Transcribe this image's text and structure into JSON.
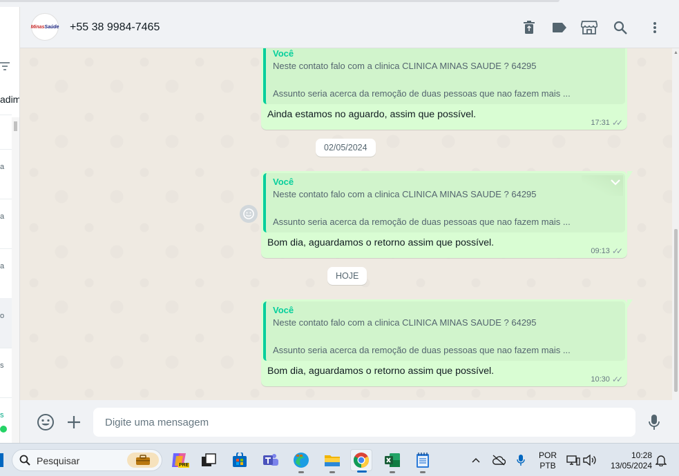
{
  "left_panel": {
    "fragments": [
      "adim",
      "a",
      "a",
      "a",
      "o",
      "s",
      "s"
    ]
  },
  "header": {
    "avatar_text_a": "Minas",
    "avatar_text_b": "Saúde",
    "contact_name": "+55 38 9984-7465"
  },
  "chat": {
    "messages": [
      {
        "quote_author": "Você",
        "quote_line1": "Neste contato falo com a clinica  CLINICA MINAS SAUDE ? 64295",
        "quote_line2": "Assunto seria acerca da remoção de duas pessoas que nao fazem mais ...",
        "text": "Ainda estamos no aguardo, assim que possível.",
        "time": "17:31",
        "ticks": "✓✓"
      },
      {
        "quote_author": "Você",
        "quote_line1": "Neste contato falo com a clinica  CLINICA MINAS SAUDE ? 64295",
        "quote_line2": "Assunto seria acerca da remoção de duas pessoas que nao fazem mais ...",
        "text": "Bom dia, aguardamos o retorno assim que possível.",
        "time": "09:13",
        "ticks": "✓✓"
      },
      {
        "quote_author": "Você",
        "quote_line1": "Neste contato falo com a clinica  CLINICA MINAS SAUDE ? 64295",
        "quote_line2": "Assunto seria acerca da remoção de duas pessoas que nao fazem mais ...",
        "text": "Bom dia, aguardamos o retorno assim que possível.",
        "time": "10:30",
        "ticks": "✓✓"
      }
    ],
    "date_chips": [
      "02/05/2024",
      "HOJE"
    ]
  },
  "composer": {
    "placeholder": "Digite uma mensagem"
  },
  "taskbar": {
    "search_label": "Pesquisar",
    "copilot_badge": "PRE",
    "lang_line1": "POR",
    "lang_line2": "PTB",
    "time": "10:28",
    "date": "13/05/2024"
  },
  "colors": {
    "bubble_out": "#d9fdd3",
    "quote_accent": "#06cf9c",
    "chat_bg": "#efeae2",
    "header_bg": "#f0f2f5"
  }
}
